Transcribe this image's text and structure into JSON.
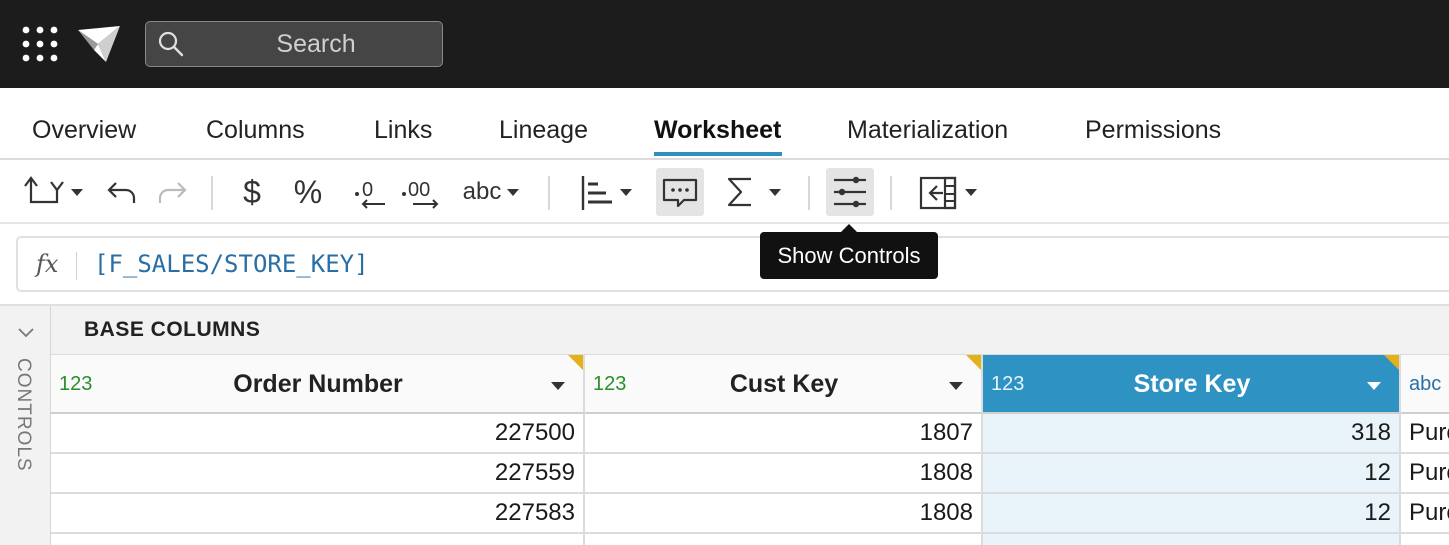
{
  "topbar": {
    "apps_icon": "grid-apps-icon",
    "logo_icon": "sigma-logo-icon",
    "search": {
      "placeholder": "Search",
      "icon": "search-icon"
    }
  },
  "tabs": [
    {
      "label": "Overview",
      "active": false
    },
    {
      "label": "Columns",
      "active": false
    },
    {
      "label": "Links",
      "active": false
    },
    {
      "label": "Lineage",
      "active": false
    },
    {
      "label": "Worksheet",
      "active": true
    },
    {
      "label": "Materialization",
      "active": false
    },
    {
      "label": "Permissions",
      "active": false
    }
  ],
  "toolbar": {
    "currency_symbol": "$",
    "percent_symbol": "%",
    "text_format_label": "abc"
  },
  "tooltip": {
    "text": "Show Controls"
  },
  "formula": {
    "fx_label": "fx",
    "expression": "[F_SALES/STORE_KEY]"
  },
  "grid": {
    "controls_label": "CONTROLS",
    "section_title": "BASE COLUMNS",
    "columns": [
      {
        "type": "123",
        "name": "Order Number"
      },
      {
        "type": "123",
        "name": "Cust Key"
      },
      {
        "type": "123",
        "name": "Store Key",
        "selected": true
      },
      {
        "type": "abc",
        "name": ""
      }
    ],
    "rows": [
      [
        "227500",
        "1807",
        "318",
        "Purc"
      ],
      [
        "227559",
        "1808",
        "12",
        "Purc"
      ],
      [
        "227583",
        "1808",
        "12",
        "Purc"
      ]
    ]
  },
  "colors": {
    "topbar_bg": "#1c1c1c",
    "accent": "#2e8fc0",
    "selected_column": "#2e92c2",
    "type_number": "#2a8f2a",
    "flag": "#e3b119"
  }
}
